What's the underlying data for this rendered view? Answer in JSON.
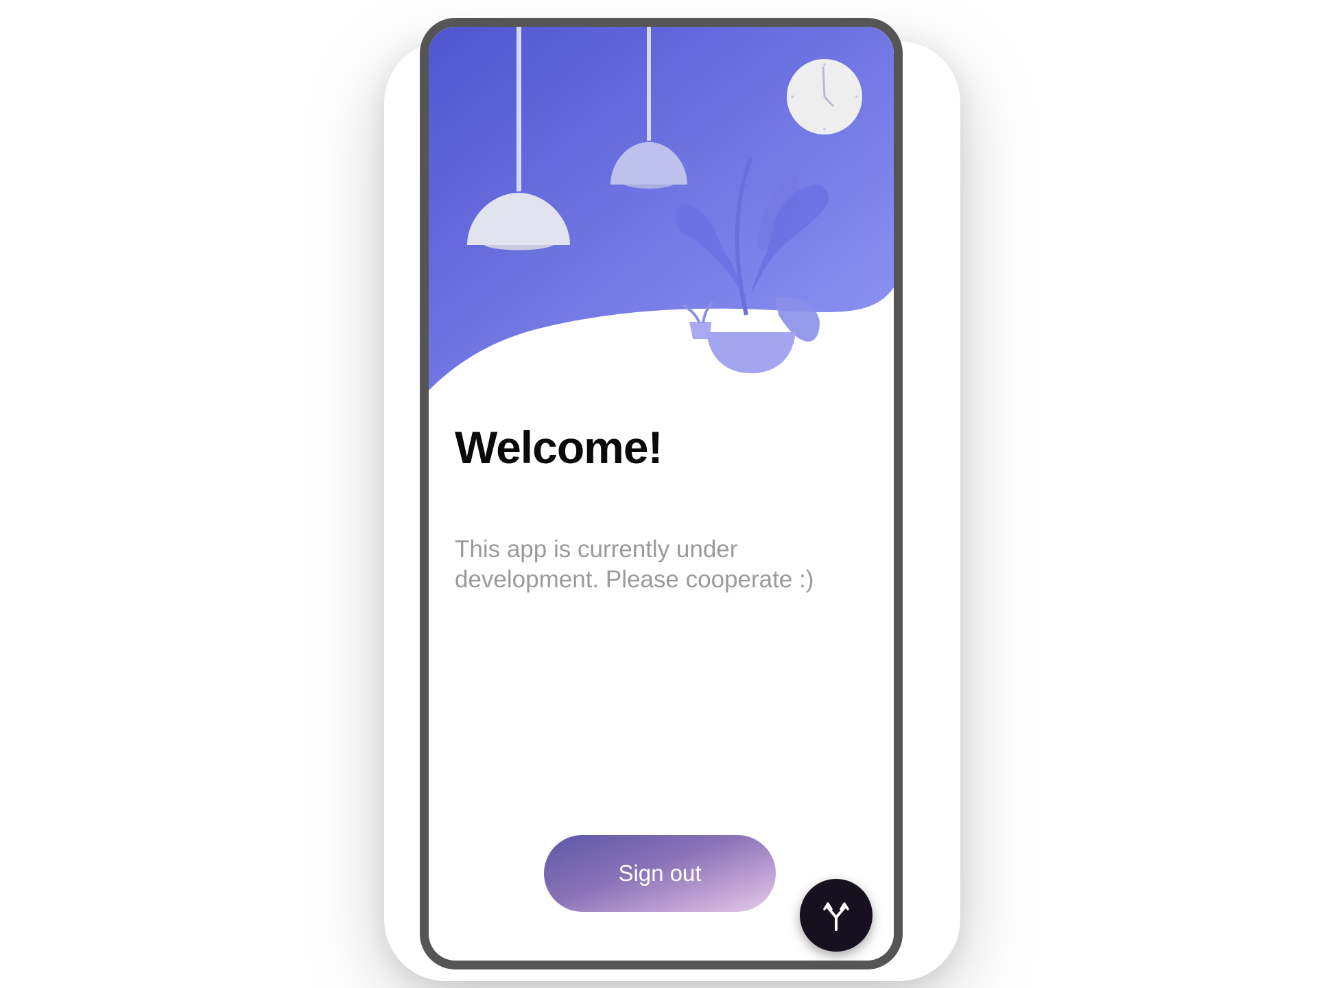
{
  "app": {
    "title": "Welcome!",
    "subtitle": "This app is currently under development. Please cooperate :)"
  },
  "actions": {
    "sign_out_label": "Sign out",
    "fab_icon": "merge-arrows-icon"
  },
  "colors": {
    "hero_gradient_start": "#4f55cf",
    "hero_gradient_end": "#8f93f4",
    "button_gradient_start": "#5c57a6",
    "button_gradient_end": "#e4cfe8",
    "fab_background": "#17111f",
    "title_color": "#0a0a0a",
    "subtitle_color": "#9a9a9a"
  }
}
